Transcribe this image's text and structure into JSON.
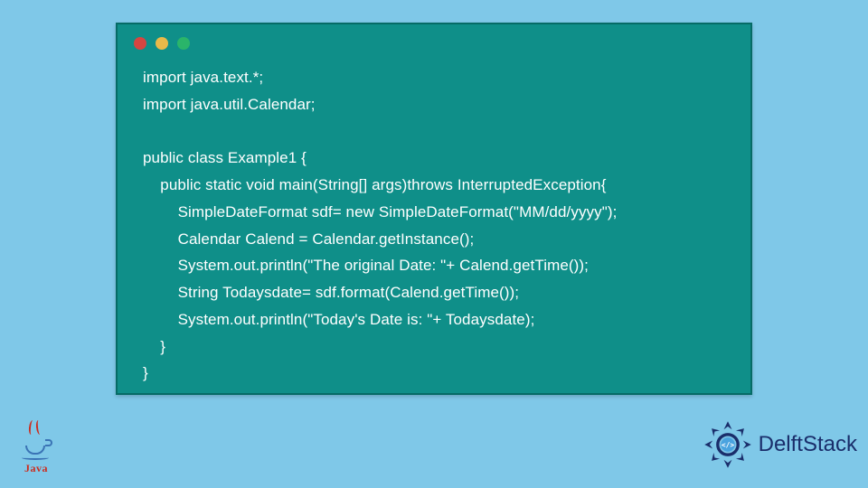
{
  "code": "import java.text.*;\nimport java.util.Calendar;\n\npublic class Example1 {\n    public static void main(String[] args)throws InterruptedException{\n        SimpleDateFormat sdf= new SimpleDateFormat(\"MM/dd/yyyy\");\n        Calendar Calend = Calendar.getInstance();\n        System.out.println(\"The original Date: \"+ Calend.getTime());\n        String Todaysdate= sdf.format(Calend.getTime());\n        System.out.println(\"Today's Date is: \"+ Todaysdate);\n    }\n}",
  "java_logo": {
    "label": "Java"
  },
  "delft_logo": {
    "text": "DelftStack"
  },
  "colors": {
    "page_bg": "#7fc8e8",
    "window_bg": "#0f8f89",
    "window_border": "#066b66",
    "code_text": "#ffffff",
    "dot_red": "#d64541",
    "dot_yellow": "#e9b949",
    "dot_green": "#2ab56a",
    "java_red": "#cc2b1d",
    "java_blue": "#3a73b5",
    "delft_blue": "#1a2e6b"
  }
}
